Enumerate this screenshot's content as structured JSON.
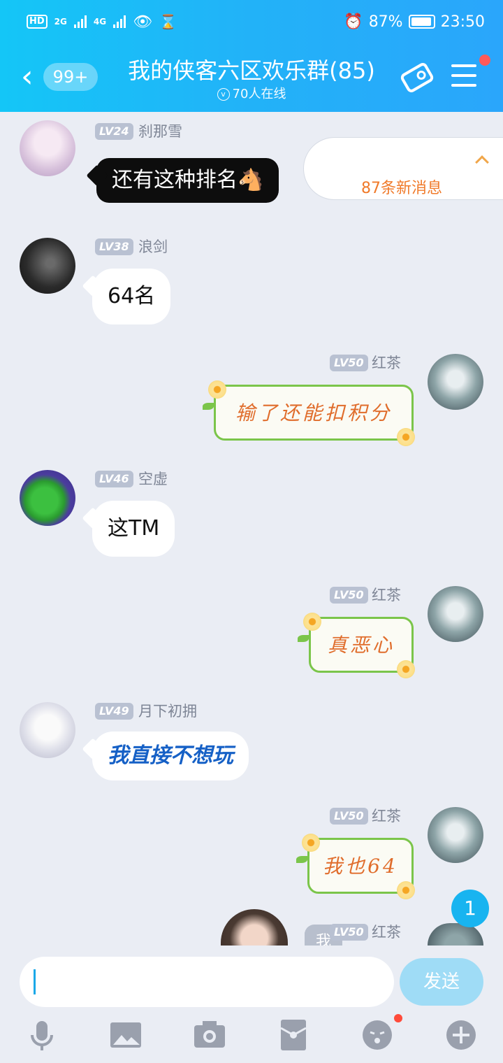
{
  "status_bar": {
    "hd": "HD",
    "net1": "2G",
    "net2": "4G",
    "battery": "87%",
    "time": "23:50"
  },
  "header": {
    "unread_badge": "99+",
    "title": "我的侠客六区欢乐群(85)",
    "online": "70人在线"
  },
  "new_messages": "87条新消息",
  "messages": [
    {
      "level": "LV24",
      "name": "刹那雪",
      "text": "还有这种排名🐴"
    },
    {
      "level": "LV38",
      "name": "浪剑",
      "text": "64名"
    },
    {
      "level": "LV50",
      "name": "红茶",
      "text": "输了还能扣积分"
    },
    {
      "level": "LV46",
      "name": "空虚",
      "text": "这TM"
    },
    {
      "level": "LV50",
      "name": "红茶",
      "text": "真恶心"
    },
    {
      "level": "LV49",
      "name": "月下初拥",
      "text": "我直接不想玩"
    },
    {
      "level": "LV50",
      "name": "红茶",
      "text": "我也64"
    },
    {
      "level": "LV50",
      "name": "红茶",
      "text": "我"
    }
  ],
  "unread_count": "1",
  "input": {
    "placeholder": "",
    "send_label": "发送"
  },
  "toolbar_icons": [
    "microphone-icon",
    "image-icon",
    "camera-icon",
    "red-packet-icon",
    "emoji-icon",
    "plus-icon"
  ],
  "colors": {
    "header_start": "#14c6f7",
    "header_end": "#2aa6fb",
    "fancy_border": "#7bc54a",
    "fancy_text": "#e06d2c",
    "new_msg": "#f07a2a"
  }
}
